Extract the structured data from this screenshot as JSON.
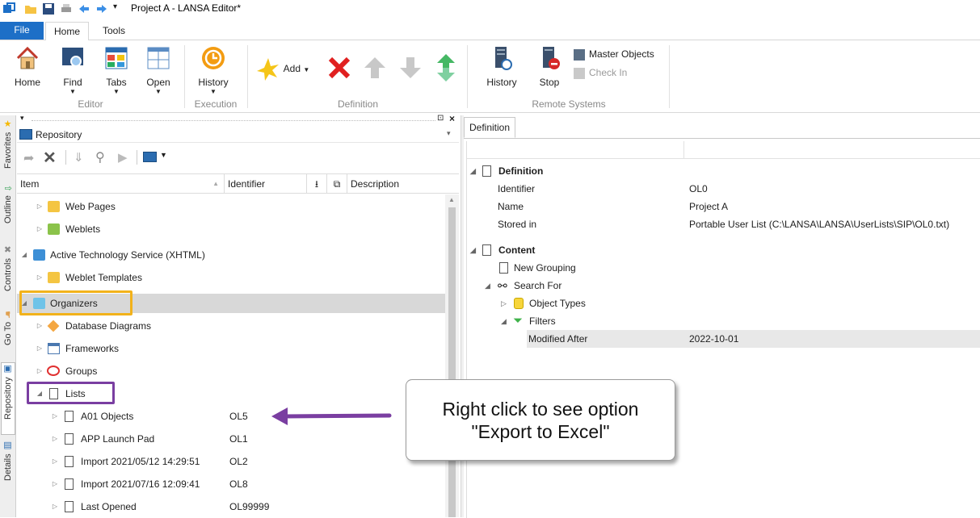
{
  "window": {
    "title": "Project A - LANSA Editor*"
  },
  "ribbon_tabs": {
    "file": "File",
    "home": "Home",
    "tools": "Tools"
  },
  "ribbon": {
    "editor": {
      "group": "Editor",
      "home": "Home",
      "find": "Find",
      "tabs": "Tabs",
      "open": "Open"
    },
    "execution": {
      "group": "Execution",
      "history": "History"
    },
    "definition": {
      "group": "Definition",
      "add": "Add"
    },
    "remote": {
      "group": "Remote Systems",
      "history": "History",
      "stop": "Stop",
      "master_objects": "Master Objects",
      "check_in": "Check In"
    }
  },
  "sidebar": {
    "favorites": "Favorites",
    "outline": "Outline",
    "controls": "Controls",
    "goto": "Go To",
    "repository": "Repository",
    "details": "Details"
  },
  "left": {
    "combo": "Repository",
    "columns": {
      "item": "Item",
      "identifier": "Identifier",
      "description": "Description"
    },
    "rows": [
      {
        "label": "Web Pages",
        "id": ""
      },
      {
        "label": "Weblets",
        "id": ""
      },
      {
        "label": "Active Technology Service (XHTML)",
        "id": ""
      },
      {
        "label": "Weblet Templates",
        "id": ""
      },
      {
        "label": "Organizers",
        "id": ""
      },
      {
        "label": "Database Diagrams",
        "id": ""
      },
      {
        "label": "Frameworks",
        "id": ""
      },
      {
        "label": "Groups",
        "id": ""
      },
      {
        "label": "Lists",
        "id": ""
      },
      {
        "label": "A01 Objects",
        "id": "OL5"
      },
      {
        "label": "APP Launch Pad",
        "id": "OL1"
      },
      {
        "label": "Import 2021/05/12 14:29:51",
        "id": "OL2"
      },
      {
        "label": "Import 2021/07/16 12:09:41",
        "id": "OL8"
      },
      {
        "label": "Last Opened",
        "id": "OL99999"
      }
    ]
  },
  "right": {
    "tab": "Definition",
    "definition": {
      "section": "Definition",
      "identifier_k": "Identifier",
      "identifier_v": "OL0",
      "name_k": "Name",
      "name_v": "Project A",
      "stored_k": "Stored in",
      "stored_v": "Portable User List (C:\\LANSA\\LANSA\\UserLists\\SIP\\OL0.txt)"
    },
    "content": {
      "section": "Content",
      "new_grouping": "New Grouping",
      "search_for": "Search For",
      "object_types": "Object Types",
      "filters": "Filters",
      "modified_after_k": "Modified After",
      "modified_after_v": "2022-10-01"
    }
  },
  "callout": {
    "line1": "Right click to see option",
    "line2": "\"Export to Excel\""
  },
  "colors": {
    "accent": "#1d6fc7",
    "orange_highlight": "#f2b21b",
    "purple_highlight": "#7a3ea1"
  }
}
